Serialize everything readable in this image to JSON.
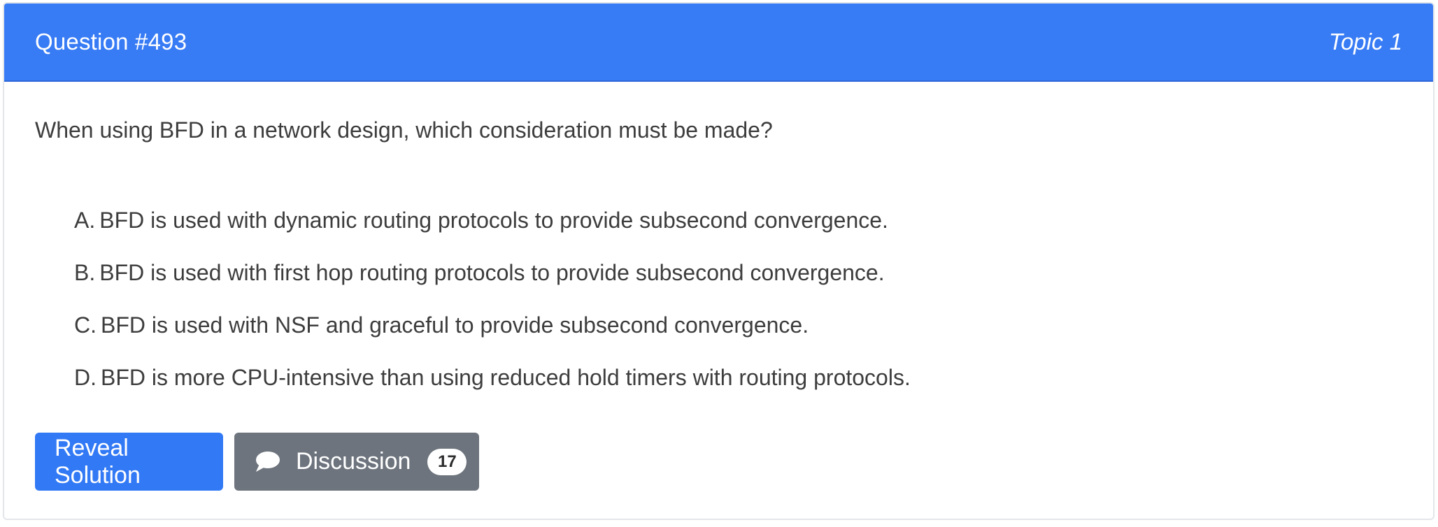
{
  "header": {
    "question_label": "Question #493",
    "topic_label": "Topic 1"
  },
  "question": {
    "text": "When using BFD in a network design, which consideration must be made?"
  },
  "choices": [
    {
      "letter": "A.",
      "text": "BFD is used with dynamic routing protocols to provide subsecond convergence."
    },
    {
      "letter": "B.",
      "text": "BFD is used with first hop routing protocols to provide subsecond convergence."
    },
    {
      "letter": "C.",
      "text": "BFD is used with NSF and graceful to provide subsecond convergence."
    },
    {
      "letter": "D.",
      "text": "BFD is more CPU-intensive than using reduced hold timers with routing protocols."
    }
  ],
  "actions": {
    "reveal_label": "Reveal Solution",
    "discussion_label": "Discussion",
    "discussion_count": "17",
    "discussion_icon": "chat-bubble-icon"
  },
  "colors": {
    "header_bg": "#377bf5",
    "reveal_bg": "#3279f5",
    "discussion_bg": "#6d747d",
    "text": "#3d3d3d"
  }
}
